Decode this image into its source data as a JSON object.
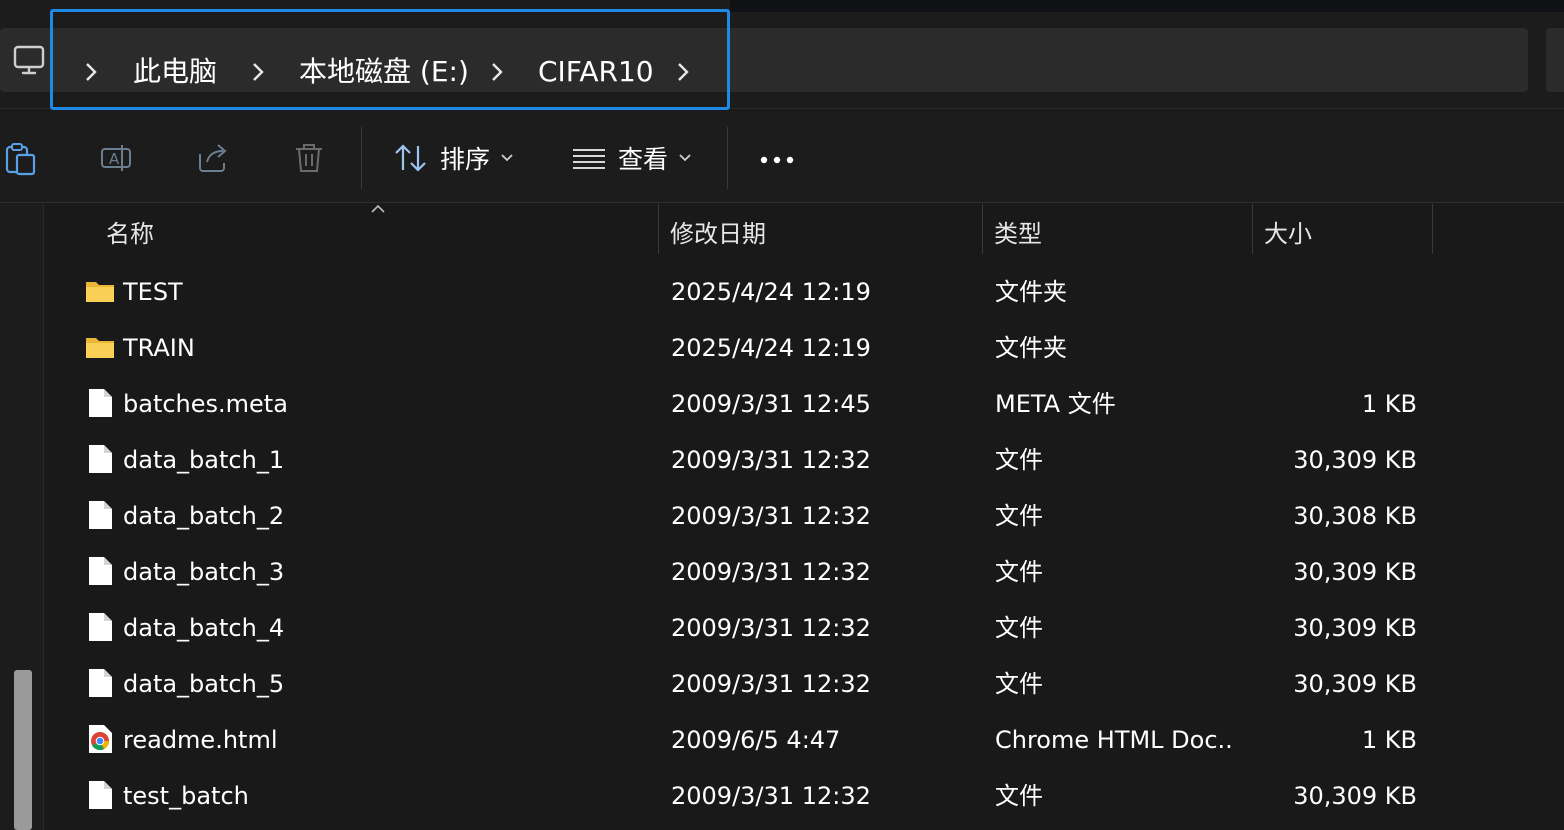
{
  "breadcrumb": {
    "root_icon": "this-pc-icon",
    "items": [
      "此电脑",
      "本地磁盘 (E:)",
      "CIFAR10"
    ]
  },
  "toolbar": {
    "icons": [
      "paste-icon",
      "rename-icon",
      "share-icon",
      "delete-icon"
    ],
    "sort_label": "排序",
    "view_label": "查看",
    "more_icon": "more-icon"
  },
  "columns": {
    "name": "名称",
    "modified": "修改日期",
    "type": "类型",
    "size": "大小"
  },
  "files": [
    {
      "icon": "folder-icon",
      "name": "TEST",
      "modified": "2025/4/24 12:19",
      "type": "文件夹",
      "size": ""
    },
    {
      "icon": "folder-icon",
      "name": "TRAIN",
      "modified": "2025/4/24 12:19",
      "type": "文件夹",
      "size": ""
    },
    {
      "icon": "file-icon",
      "name": "batches.meta",
      "modified": "2009/3/31 12:45",
      "type": "META 文件",
      "size": "1 KB"
    },
    {
      "icon": "file-icon",
      "name": "data_batch_1",
      "modified": "2009/3/31 12:32",
      "type": "文件",
      "size": "30,309 KB"
    },
    {
      "icon": "file-icon",
      "name": "data_batch_2",
      "modified": "2009/3/31 12:32",
      "type": "文件",
      "size": "30,308 KB"
    },
    {
      "icon": "file-icon",
      "name": "data_batch_3",
      "modified": "2009/3/31 12:32",
      "type": "文件",
      "size": "30,309 KB"
    },
    {
      "icon": "file-icon",
      "name": "data_batch_4",
      "modified": "2009/3/31 12:32",
      "type": "文件",
      "size": "30,309 KB"
    },
    {
      "icon": "file-icon",
      "name": "data_batch_5",
      "modified": "2009/3/31 12:32",
      "type": "文件",
      "size": "30,309 KB"
    },
    {
      "icon": "chrome-icon",
      "name": "readme.html",
      "modified": "2009/6/5 4:47",
      "type": "Chrome HTML Doc...",
      "size": "1 KB"
    },
    {
      "icon": "file-icon",
      "name": "test_batch",
      "modified": "2009/3/31 12:32",
      "type": "文件",
      "size": "30,309 KB"
    }
  ],
  "colors": {
    "accent": "#1f8ae6",
    "folder": "#f4c542",
    "background": "#191919"
  }
}
